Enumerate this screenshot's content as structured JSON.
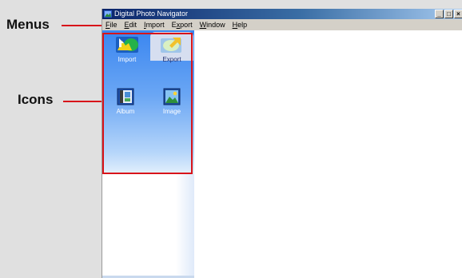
{
  "callouts": {
    "menus_label": "Menus",
    "icons_label": "Icons",
    "highlight_color": "#d8141a"
  },
  "window": {
    "title": "Digital Photo Navigator",
    "controls": {
      "minimize": "_",
      "maximize": "□",
      "close": "×"
    }
  },
  "menubar": {
    "items": [
      {
        "mnemonic": "F",
        "rest": "ile"
      },
      {
        "mnemonic": "E",
        "rest": "dit"
      },
      {
        "mnemonic": "I",
        "rest": "mport"
      },
      {
        "pre": "E",
        "mnemonic": "x",
        "rest": "port"
      },
      {
        "mnemonic": "W",
        "rest": "indow"
      },
      {
        "mnemonic": "H",
        "rest": "elp"
      }
    ]
  },
  "panel": {
    "tabs": [
      {
        "label": "Import",
        "icon": "import-icon",
        "selected": true
      },
      {
        "label": "Export",
        "icon": "export-icon",
        "selected": false
      }
    ],
    "icons": [
      {
        "label": "Album",
        "icon": "album-icon"
      },
      {
        "label": "Image",
        "icon": "image-icon"
      }
    ]
  }
}
